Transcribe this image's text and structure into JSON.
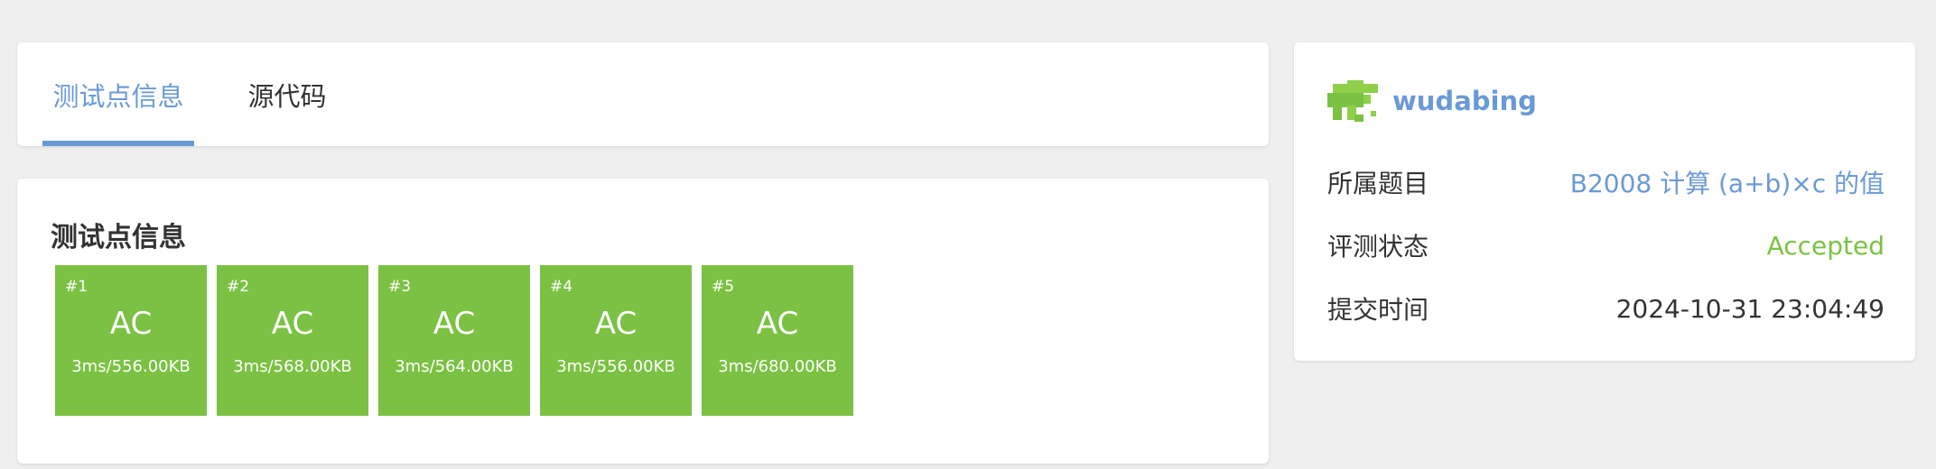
{
  "tabs": [
    {
      "label": "测试点信息",
      "active": true
    },
    {
      "label": "源代码",
      "active": false
    }
  ],
  "testcases": {
    "title": "测试点信息",
    "items": [
      {
        "id": "#1",
        "status": "AC",
        "meta": "3ms/556.00KB"
      },
      {
        "id": "#2",
        "status": "AC",
        "meta": "3ms/568.00KB"
      },
      {
        "id": "#3",
        "status": "AC",
        "meta": "3ms/564.00KB"
      },
      {
        "id": "#4",
        "status": "AC",
        "meta": "3ms/556.00KB"
      },
      {
        "id": "#5",
        "status": "AC",
        "meta": "3ms/680.00KB"
      }
    ]
  },
  "info": {
    "username": "wudabing",
    "rows": [
      {
        "label": "所属题目",
        "value": "B2008 计算 (a+b)×c 的值"
      },
      {
        "label": "评测状态",
        "value": "Accepted"
      },
      {
        "label": "提交时间",
        "value": "2024-10-31 23:04:49"
      }
    ]
  },
  "colors": {
    "accent": "#6a9ad6",
    "accepted": "#7bc143",
    "background": "#efefef"
  },
  "icons": {
    "avatar": "pixel-identicon"
  }
}
